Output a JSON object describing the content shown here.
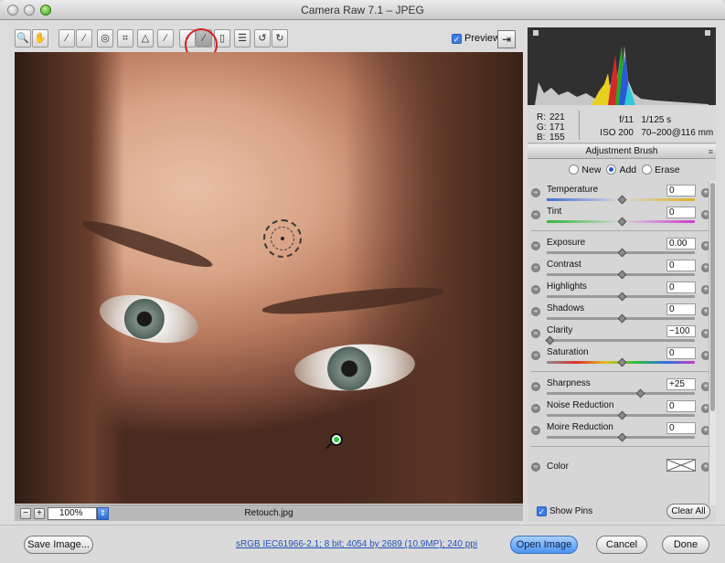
{
  "window": {
    "title": "Camera Raw 7.1  –  JPEG"
  },
  "toolbar": {
    "tools": [
      {
        "icon": "zoom-icon",
        "glyph": "🔍"
      },
      {
        "icon": "hand-icon",
        "glyph": "✋"
      },
      {
        "icon": "white-balance-icon",
        "glyph": "⁄"
      },
      {
        "icon": "color-sampler-icon",
        "glyph": "⁄"
      },
      {
        "icon": "targeted-adjustment-icon",
        "glyph": "◎"
      },
      {
        "icon": "crop-icon",
        "glyph": "⌗"
      },
      {
        "icon": "straighten-icon",
        "glyph": "△"
      },
      {
        "icon": "spot-removal-icon",
        "glyph": "⁄"
      },
      {
        "icon": "red-eye-icon",
        "glyph": "◦"
      },
      {
        "icon": "adjustment-brush-icon",
        "glyph": "⁄"
      },
      {
        "icon": "graduated-filter-icon",
        "glyph": "▯"
      },
      {
        "icon": "preferences-icon",
        "glyph": "☰"
      },
      {
        "icon": "rotate-left-icon",
        "glyph": "↺"
      },
      {
        "icon": "rotate-right-icon",
        "glyph": "↻"
      }
    ],
    "preview_label": "Preview",
    "preview_checked": true
  },
  "image": {
    "filename": "Retouch.jpg",
    "zoom": "100%"
  },
  "readout": {
    "r_label": "R:",
    "r": "221",
    "g_label": "G:",
    "g": "171",
    "b_label": "B:",
    "b": "155",
    "aperture": "f/11",
    "shutter": "1/125 s",
    "iso": "ISO 200",
    "lens": "70–200@116 mm"
  },
  "panel": {
    "title": "Adjustment Brush",
    "modes": [
      "New",
      "Add",
      "Erase"
    ],
    "selected_mode": "Add",
    "groups": [
      [
        {
          "label": "Temperature",
          "value": "0",
          "pos": 0.5
        },
        {
          "label": "Tint",
          "value": "0",
          "pos": 0.5
        }
      ],
      [
        {
          "label": "Exposure",
          "value": "0.00",
          "pos": 0.5
        },
        {
          "label": "Contrast",
          "value": "0",
          "pos": 0.5
        },
        {
          "label": "Highlights",
          "value": "0",
          "pos": 0.5
        },
        {
          "label": "Shadows",
          "value": "0",
          "pos": 0.5
        },
        {
          "label": "Clarity",
          "value": "−100",
          "pos": 0.0
        },
        {
          "label": "Saturation",
          "value": "0",
          "pos": 0.5
        }
      ],
      [
        {
          "label": "Sharpness",
          "value": "+25",
          "pos": 0.625
        },
        {
          "label": "Noise Reduction",
          "value": "0",
          "pos": 0.5
        },
        {
          "label": "Moire Reduction",
          "value": "0",
          "pos": 0.5
        }
      ]
    ],
    "color_label": "Color",
    "show_pins_label": "Show Pins",
    "clear_all_label": "Clear All"
  },
  "bottom": {
    "save_label": "Save Image...",
    "workflow_text": "sRGB IEC61966-2.1; 8 bit; 4054 by 2689 (10.9MP); 240 ppi",
    "open_label": "Open Image",
    "cancel_label": "Cancel",
    "done_label": "Done"
  },
  "colors": {
    "accent_blue": "#4b93f0",
    "highlight_circle": "#d42020",
    "pin_green": "#2fc73d"
  }
}
